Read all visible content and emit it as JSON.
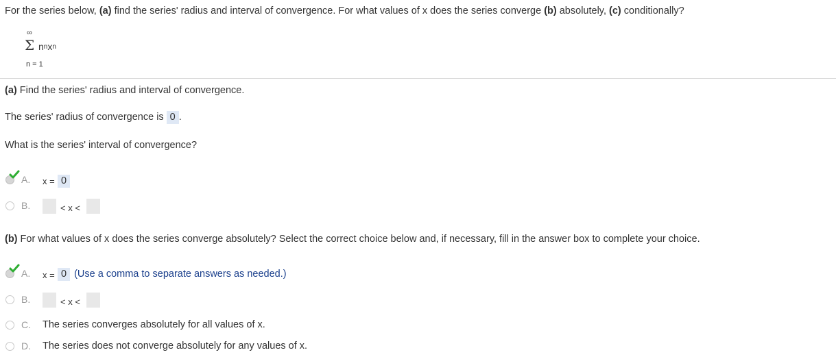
{
  "question": {
    "intro": "For the series below, ",
    "a_label": "(a)",
    "intro_mid": " find the series' radius and interval of convergence. For what values of x does the series converge ",
    "b_label": "(b)",
    "intro_mid2": " absolutely, ",
    "c_label": "(c)",
    "intro_end": " conditionally?"
  },
  "series": {
    "upper": "∞",
    "symbol": "Σ",
    "term_base_n": "n",
    "term_exp_n": "n",
    "term_base_x": "x",
    "term_exp_x": "n",
    "lower": "n = 1"
  },
  "part_a": {
    "label": "(a)",
    "heading": " Find the series' radius and interval of convergence.",
    "radius_text": "The series' radius of convergence is",
    "radius_value": "0",
    "radius_end": ".",
    "interval_question": "What is the series' interval of convergence?",
    "choices": [
      {
        "letter": "A.",
        "prefix": "x =",
        "value": "0",
        "selected": true
      },
      {
        "letter": "B.",
        "middle": "< x <",
        "selected": false
      }
    ]
  },
  "part_b": {
    "label": "(b)",
    "heading": " For what values of x does the series converge absolutely? Select the correct choice below and, if necessary, fill in the answer box to complete your choice.",
    "choices": [
      {
        "letter": "A.",
        "prefix": "x =",
        "value": "0",
        "hint": "(Use a comma to separate answers as needed.)",
        "selected": true
      },
      {
        "letter": "B.",
        "middle": "< x <",
        "selected": false
      },
      {
        "letter": "C.",
        "text": "The series converges absolutely for all values of x.",
        "selected": false
      },
      {
        "letter": "D.",
        "text": "The series does not converge absolutely for any values of x.",
        "selected": false
      }
    ]
  },
  "colors": {
    "answer_box": "#dfe8f5",
    "hint_text": "#1a3f8c",
    "check_green": "#2eae33"
  }
}
